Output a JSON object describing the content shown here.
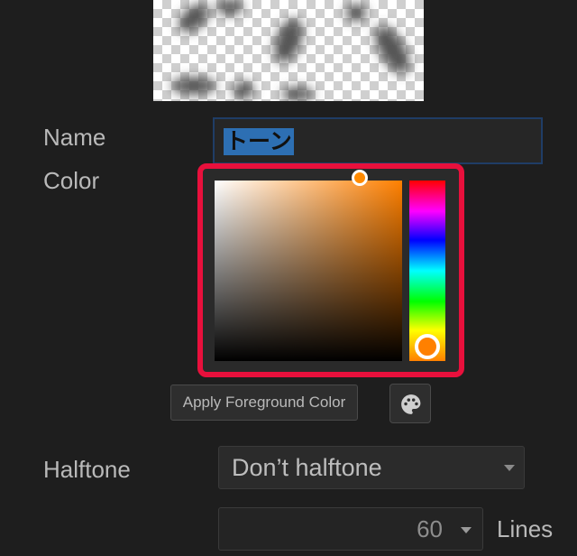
{
  "layer": {
    "name_label": "Name",
    "name_value": "トーン",
    "color_label": "Color"
  },
  "color_picker": {
    "hue": "#ff8000",
    "selected_color": "#ff8a00",
    "apply_button_label": "Apply Foreground Color",
    "palette_icon": "palette-icon"
  },
  "halftone": {
    "label": "Halftone",
    "selected": "Don’t halftone"
  },
  "lines": {
    "value": "60",
    "unit_label": "Lines"
  }
}
